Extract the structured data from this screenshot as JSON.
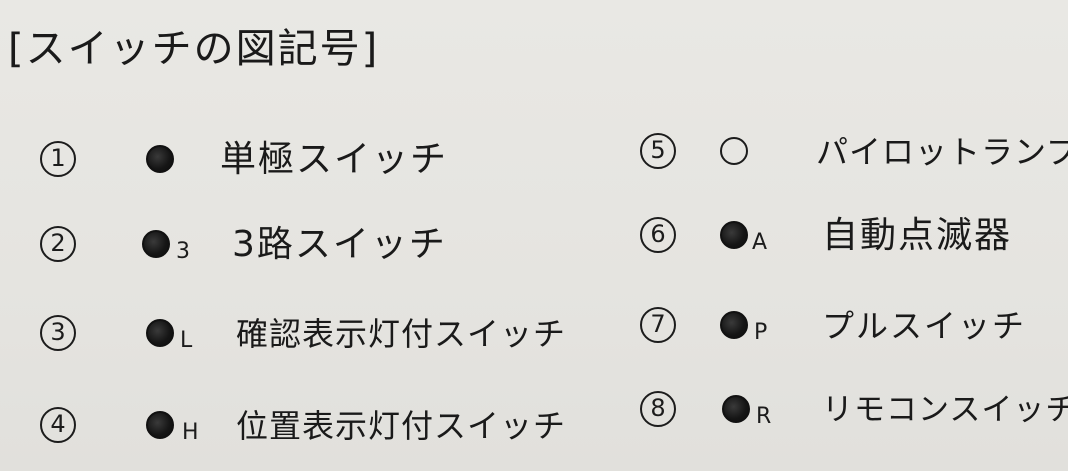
{
  "title": "[スイッチの図記号]",
  "items": [
    {
      "num": "1",
      "symbol_type": "filled",
      "sub": "",
      "name": "単極スイッチ"
    },
    {
      "num": "2",
      "symbol_type": "filled",
      "sub": "3",
      "name": "3路スイッチ"
    },
    {
      "num": "3",
      "symbol_type": "filled",
      "sub": "L",
      "name": "確認表示灯付スイッチ"
    },
    {
      "num": "4",
      "symbol_type": "filled",
      "sub": "H",
      "name": "位置表示灯付スイッチ"
    },
    {
      "num": "5",
      "symbol_type": "open",
      "sub": "",
      "name": "パイロットランプ"
    },
    {
      "num": "6",
      "symbol_type": "filled",
      "sub": "A",
      "name": "自動点滅器"
    },
    {
      "num": "7",
      "symbol_type": "filled",
      "sub": "P",
      "name": "プルスイッチ"
    },
    {
      "num": "8",
      "symbol_type": "filled",
      "sub": "R",
      "name": "リモコンスイッチ"
    }
  ],
  "colors": {
    "paper": "#e6e5e1",
    "ink": "#1c1c1c"
  }
}
